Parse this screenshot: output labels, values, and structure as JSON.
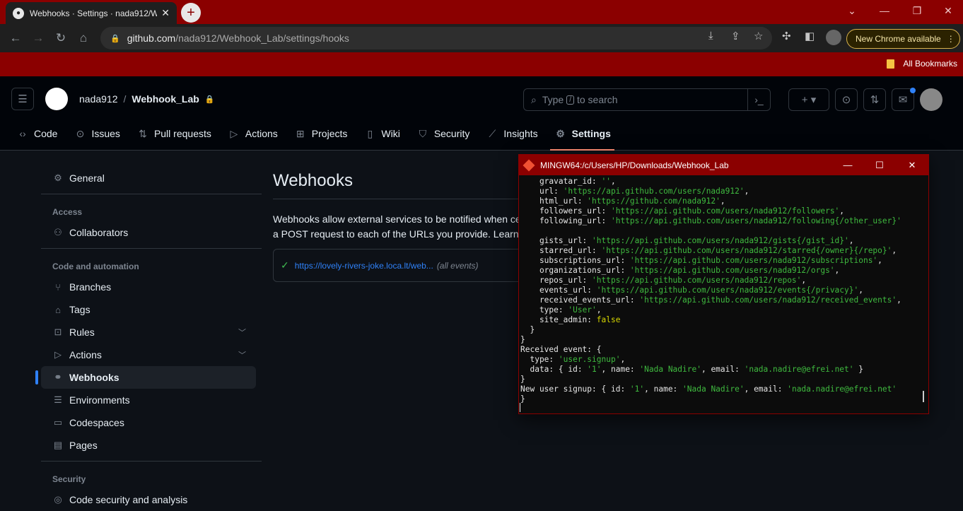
{
  "browser": {
    "tab_title": "Webhooks · Settings · nada912/W",
    "url_host": "github.com",
    "url_path": "/nada912/Webhook_Lab/settings/hooks",
    "update_label": "New Chrome available",
    "bookmarks_label": "All Bookmarks",
    "theme_color": "#8b0000"
  },
  "github": {
    "owner": "nada912",
    "repo": "Webhook_Lab",
    "search_prefix": "Type",
    "search_key": "/",
    "search_suffix": "to search",
    "tabs": [
      {
        "label": "Code",
        "icon": "code-icon"
      },
      {
        "label": "Issues",
        "icon": "issue-icon"
      },
      {
        "label": "Pull requests",
        "icon": "pull-request-icon"
      },
      {
        "label": "Actions",
        "icon": "play-icon"
      },
      {
        "label": "Projects",
        "icon": "table-icon"
      },
      {
        "label": "Wiki",
        "icon": "book-icon"
      },
      {
        "label": "Security",
        "icon": "shield-icon"
      },
      {
        "label": "Insights",
        "icon": "graph-icon"
      },
      {
        "label": "Settings",
        "icon": "gear-icon"
      }
    ],
    "sidebar": {
      "general": "General",
      "access_heading": "Access",
      "collaborators": "Collaborators",
      "code_heading": "Code and automation",
      "branches": "Branches",
      "tags": "Tags",
      "rules": "Rules",
      "actions": "Actions",
      "webhooks": "Webhooks",
      "environments": "Environments",
      "codespaces": "Codespaces",
      "pages": "Pages",
      "security_heading": "Security",
      "code_security": "Code security and analysis"
    },
    "main": {
      "title": "Webhooks",
      "desc_line1": "Webhooks allow external services to be notified when ce",
      "desc_line2": "a POST request to each of the URLs you provide. Learn m",
      "hook_url": "https://lovely-rivers-joke.loca.lt/web...",
      "hook_events": "(all events)"
    }
  },
  "terminal": {
    "title": "MINGW64:/c/Users/HP/Downloads/Webhook_Lab",
    "lines": [
      [
        [
          "    gravatar_id: ",
          ""
        ],
        [
          "''",
          "str"
        ],
        [
          ",",
          ""
        ]
      ],
      [
        [
          "    url: ",
          ""
        ],
        [
          "'https://api.github.com/users/nada912'",
          "str"
        ],
        [
          ",",
          ""
        ]
      ],
      [
        [
          "    html_url: ",
          ""
        ],
        [
          "'https://github.com/nada912'",
          "str"
        ],
        [
          ",",
          ""
        ]
      ],
      [
        [
          "    followers_url: ",
          ""
        ],
        [
          "'https://api.github.com/users/nada912/followers'",
          "str"
        ],
        [
          ",",
          ""
        ]
      ],
      [
        [
          "    following_url: ",
          ""
        ],
        [
          "'https://api.github.com/users/nada912/following{/other_user}'",
          "str"
        ]
      ],
      [
        [
          "",
          ""
        ]
      ],
      [
        [
          "    gists_url: ",
          ""
        ],
        [
          "'https://api.github.com/users/nada912/gists{/gist_id}'",
          "str"
        ],
        [
          ",",
          ""
        ]
      ],
      [
        [
          "    starred_url: ",
          ""
        ],
        [
          "'https://api.github.com/users/nada912/starred{/owner}{/repo}'",
          "str"
        ],
        [
          ",",
          ""
        ]
      ],
      [
        [
          "    subscriptions_url: ",
          ""
        ],
        [
          "'https://api.github.com/users/nada912/subscriptions'",
          "str"
        ],
        [
          ",",
          ""
        ]
      ],
      [
        [
          "    organizations_url: ",
          ""
        ],
        [
          "'https://api.github.com/users/nada912/orgs'",
          "str"
        ],
        [
          ",",
          ""
        ]
      ],
      [
        [
          "    repos_url: ",
          ""
        ],
        [
          "'https://api.github.com/users/nada912/repos'",
          "str"
        ],
        [
          ",",
          ""
        ]
      ],
      [
        [
          "    events_url: ",
          ""
        ],
        [
          "'https://api.github.com/users/nada912/events{/privacy}'",
          "str"
        ],
        [
          ",",
          ""
        ]
      ],
      [
        [
          "    received_events_url: ",
          ""
        ],
        [
          "'https://api.github.com/users/nada912/received_events'",
          "str"
        ],
        [
          ",",
          ""
        ]
      ],
      [
        [
          "    type: ",
          ""
        ],
        [
          "'User'",
          "str"
        ],
        [
          ",",
          ""
        ]
      ],
      [
        [
          "    site_admin: ",
          ""
        ],
        [
          "false",
          "kw"
        ]
      ],
      [
        [
          "  }",
          ""
        ]
      ],
      [
        [
          "}",
          ""
        ]
      ],
      [
        [
          "Received event: {",
          ""
        ]
      ],
      [
        [
          "  type: ",
          ""
        ],
        [
          "'user.signup'",
          "str"
        ],
        [
          ",",
          ""
        ]
      ],
      [
        [
          "  data: { id: ",
          ""
        ],
        [
          "'1'",
          "str"
        ],
        [
          ", name: ",
          ""
        ],
        [
          "'Nada Nadire'",
          "str"
        ],
        [
          ", email: ",
          ""
        ],
        [
          "'nada.nadire@efrei.net'",
          "str"
        ],
        [
          " }",
          ""
        ]
      ],
      [
        [
          "}",
          ""
        ]
      ],
      [
        [
          "New user signup: { id: ",
          ""
        ],
        [
          "'1'",
          "str"
        ],
        [
          ", name: ",
          ""
        ],
        [
          "'Nada Nadire'",
          "str"
        ],
        [
          ", email: ",
          ""
        ],
        [
          "'nada.nadire@efrei.net'",
          "str"
        ],
        [
          " ",
          ""
        ]
      ],
      [
        [
          "}",
          ""
        ]
      ]
    ]
  }
}
